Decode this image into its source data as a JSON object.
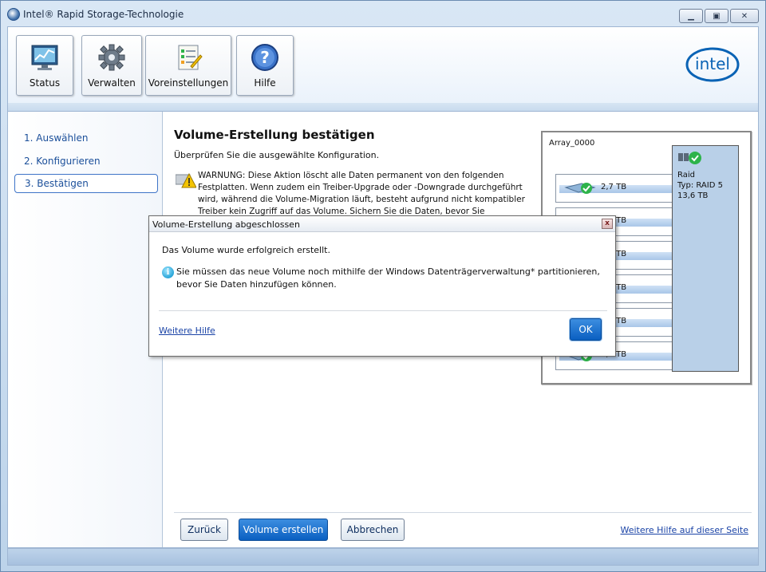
{
  "window": {
    "title": "Intel® Rapid Storage-Technologie",
    "controls": [
      "minimize-icon",
      "maximize-icon",
      "close-icon"
    ]
  },
  "toolbar": {
    "buttons": [
      {
        "label": "Status",
        "icon": "monitor-chart-icon"
      },
      {
        "label": "Verwalten",
        "icon": "gear-icon"
      },
      {
        "label": "Voreinstellungen",
        "icon": "checklist-icon"
      },
      {
        "label": "Hilfe",
        "icon": "help-icon"
      }
    ],
    "brand": "intel"
  },
  "sidebar": {
    "steps": [
      {
        "label": "1. Auswählen"
      },
      {
        "label": "2. Konfigurieren"
      },
      {
        "label": "3. Bestätigen",
        "active": true
      }
    ]
  },
  "content": {
    "title": "Volume-Erstellung bestätigen",
    "subtitle": "Überprüfen Sie die ausgewählte Konfiguration.",
    "warning": "WARNUNG: Diese Aktion löscht alle Daten permanent von den folgenden Festplatten. Wenn zudem ein Treiber-Upgrade oder -Downgrade durchgeführt wird, während die Volume-Migration läuft, besteht aufgrund nicht kompatibler Treiber kein Zugriff auf das Volume. Sichern Sie die Daten, bevor Sie fortfahren."
  },
  "array": {
    "name": "Array_0000",
    "disks": [
      {
        "size": "2,7 TB"
      },
      {
        "size": "2,7 TB"
      },
      {
        "size": "2,7 TB"
      },
      {
        "size": "2,7 TB"
      },
      {
        "size": "2,7 TB"
      },
      {
        "size": "2,7 TB"
      }
    ],
    "raid": {
      "label": "Raid",
      "type": "Typ: RAID 5",
      "capacity": "13,6 TB"
    }
  },
  "footer": {
    "back": "Zurück",
    "create": "Volume erstellen",
    "cancel": "Abbrechen",
    "help_link": "Weitere Hilfe auf dieser Seite"
  },
  "dialog": {
    "title": "Volume-Erstellung abgeschlossen",
    "message": "Das Volume wurde erfolgreich erstellt.",
    "info": "Sie müssen das neue Volume noch mithilfe der Windows Datenträgerverwaltung* partitionieren, bevor Sie Daten hinzufügen können.",
    "help_link": "Weitere Hilfe",
    "ok": "OK",
    "close_glyph": "x"
  },
  "colors": {
    "accent": "#0a5fc1",
    "link": "#1a43a6",
    "raid_panel": "#b9d0e8",
    "ok_check": "#2db34a"
  }
}
